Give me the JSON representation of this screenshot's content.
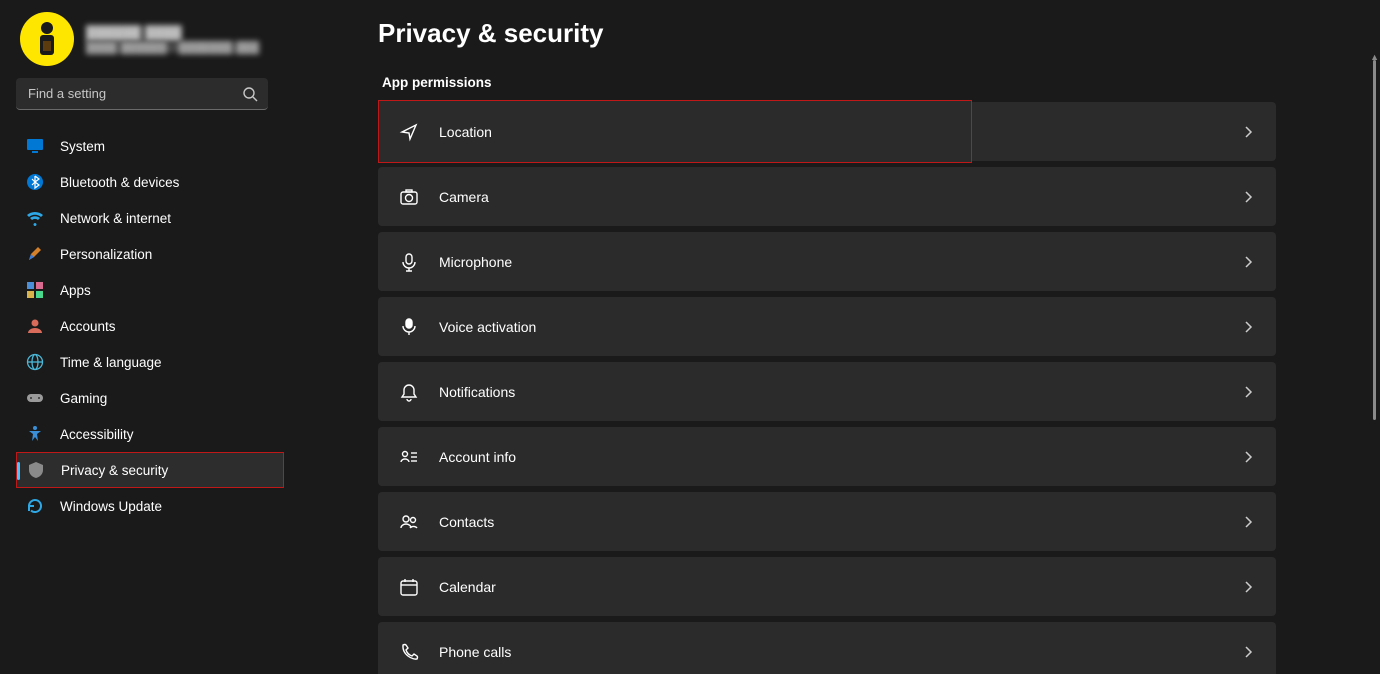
{
  "profile": {
    "name": "██████ ████",
    "email": "████.██████@███████.███"
  },
  "search": {
    "placeholder": "Find a setting"
  },
  "sidebar": {
    "items": [
      {
        "label": "System"
      },
      {
        "label": "Bluetooth & devices"
      },
      {
        "label": "Network & internet"
      },
      {
        "label": "Personalization"
      },
      {
        "label": "Apps"
      },
      {
        "label": "Accounts"
      },
      {
        "label": "Time & language"
      },
      {
        "label": "Gaming"
      },
      {
        "label": "Accessibility"
      },
      {
        "label": "Privacy & security"
      },
      {
        "label": "Windows Update"
      }
    ]
  },
  "page": {
    "title": "Privacy & security"
  },
  "section": {
    "header": "App permissions"
  },
  "cards": [
    {
      "label": "Location"
    },
    {
      "label": "Camera"
    },
    {
      "label": "Microphone"
    },
    {
      "label": "Voice activation"
    },
    {
      "label": "Notifications"
    },
    {
      "label": "Account info"
    },
    {
      "label": "Contacts"
    },
    {
      "label": "Calendar"
    },
    {
      "label": "Phone calls"
    }
  ]
}
